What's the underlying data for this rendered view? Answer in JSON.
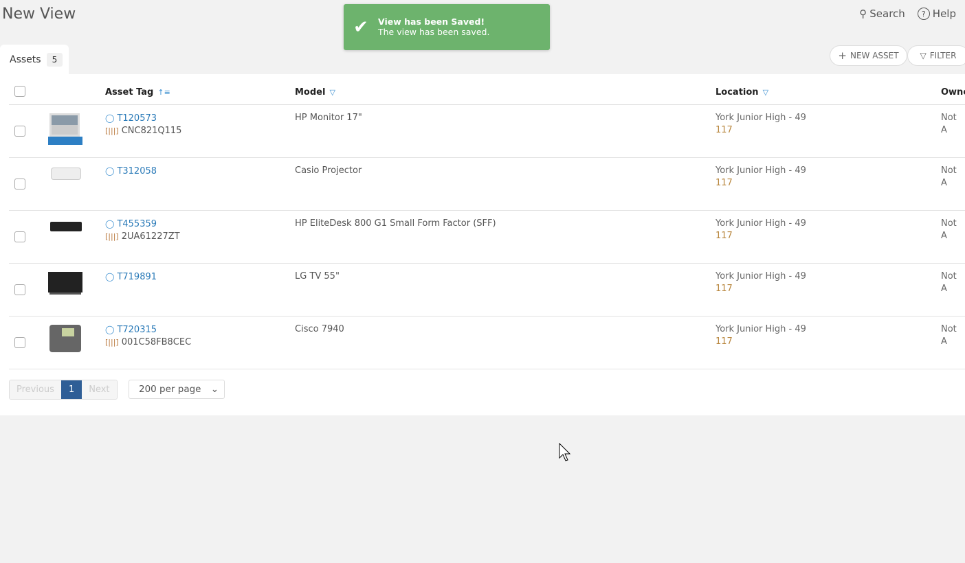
{
  "header": {
    "title": "New View",
    "search": "Search",
    "help": "Help"
  },
  "toast": {
    "title": "View has been Saved!",
    "message": "The view has been saved.",
    "color": "#6db36d"
  },
  "tab": {
    "label": "Assets",
    "count": "5"
  },
  "toolbar": {
    "new_asset": "NEW ASSET",
    "filter": "FILTER"
  },
  "columns": {
    "asset_tag": "Asset Tag",
    "model": "Model",
    "location": "Location",
    "owner": "Owne"
  },
  "rows": [
    {
      "image": "monitor",
      "tag": "T120573",
      "serial": "CNC821Q115",
      "model": "HP Monitor 17\"",
      "location": "York Junior High - 49",
      "room": "117",
      "owner": "Not A"
    },
    {
      "image": "projector",
      "tag": "T312058",
      "serial": "",
      "model": "Casio Projector",
      "location": "York Junior High - 49",
      "room": "117",
      "owner": "Not A"
    },
    {
      "image": "desktop",
      "tag": "T455359",
      "serial": "2UA61227ZT",
      "model": "HP EliteDesk 800 G1 Small Form Factor (SFF)",
      "location": "York Junior High - 49",
      "room": "117",
      "owner": "Not A"
    },
    {
      "image": "tv",
      "tag": "T719891",
      "serial": "",
      "model": "LG TV 55\"",
      "location": "York Junior High - 49",
      "room": "117",
      "owner": "Not A"
    },
    {
      "image": "phone",
      "tag": "T720315",
      "serial": "001C58FB8CEC",
      "model": "Cisco 7940",
      "location": "York Junior High - 49",
      "room": "117",
      "owner": "Not A"
    }
  ],
  "pagination": {
    "previous": "Previous",
    "current": "1",
    "next": "Next",
    "per_page": "200 per page"
  }
}
